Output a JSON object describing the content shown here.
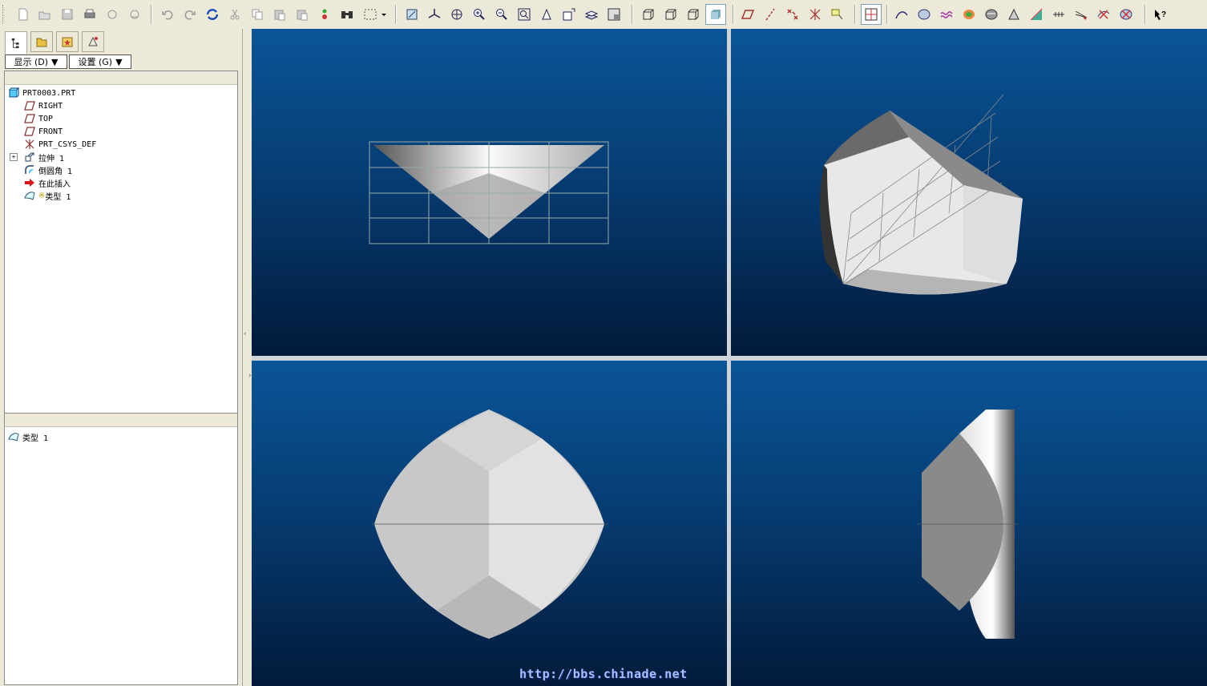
{
  "navigator": {
    "show_label": "显示 (D)",
    "settings_label": "设置 (G)"
  },
  "model_tree": {
    "items": [
      {
        "label": "PRT0003.PRT",
        "icon": "part-icon"
      },
      {
        "label": "RIGHT",
        "icon": "datum-plane-icon"
      },
      {
        "label": "TOP",
        "icon": "datum-plane-icon"
      },
      {
        "label": "FRONT",
        "icon": "datum-plane-icon"
      },
      {
        "label": "PRT_CSYS_DEF",
        "icon": "coordinate-system-icon"
      },
      {
        "label": "拉伸 1",
        "icon": "extrude-icon"
      },
      {
        "label": "倒圆角 1",
        "icon": "round-icon"
      },
      {
        "label": "在此插入",
        "icon": "insert-here-arrow-icon"
      },
      {
        "label": "类型 1",
        "icon": "style-feature-icon",
        "prefix": "※"
      }
    ]
  },
  "detail_panel": {
    "items": [
      {
        "label": "类型 1",
        "icon": "style-feature-icon"
      }
    ]
  },
  "watermark": "http://bbs.chinade.net",
  "colors": {
    "viewport_top": "#0a5598",
    "viewport_bottom": "#021a3a",
    "toolbar_bg": "#ece9d8"
  }
}
